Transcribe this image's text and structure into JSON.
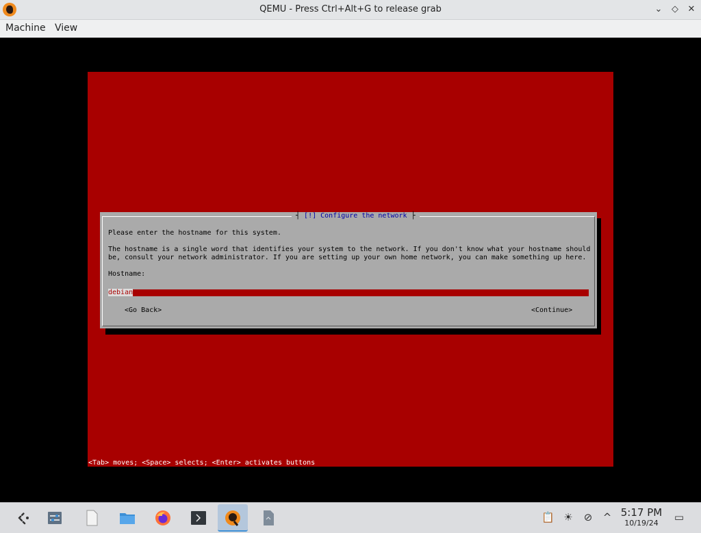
{
  "window": {
    "title": "QEMU - Press Ctrl+Alt+G to release grab",
    "min_glyph": "⌄",
    "max_glyph": "◇",
    "close_glyph": "✕"
  },
  "menu": {
    "items": [
      "Machine",
      "View"
    ]
  },
  "installer": {
    "dialog_title": "[!] Configure the network",
    "prompt": "Please enter the hostname for this system.",
    "description_line1": "The hostname is a single word that identifies your system to the network. If you don't know what your hostname should",
    "description_line2": "be, consult your network administrator. If you are setting up your own home network, you can make something up here.",
    "field_label": "Hostname:",
    "hostname_value": "debian",
    "go_back_label": "<Go Back>",
    "continue_label": "<Continue>",
    "help_text": "<Tab> moves; <Space> selects; <Enter> activates buttons"
  },
  "colors": {
    "screen_bg": "#a80000",
    "dialog_bg": "#aaaaaa",
    "dialog_title": "#0000a8"
  },
  "taskbar": {
    "apps": [
      "app-launcher-icon",
      "system-settings-icon",
      "files-icon",
      "folder-icon",
      "firefox-icon",
      "terminal-icon",
      "qemu-icon",
      "document-icon"
    ],
    "tray": [
      "clipboard-icon",
      "brightness-icon",
      "network-icon",
      "expand-tray-icon"
    ],
    "time": "5:17 PM",
    "date": "10/19/24"
  }
}
